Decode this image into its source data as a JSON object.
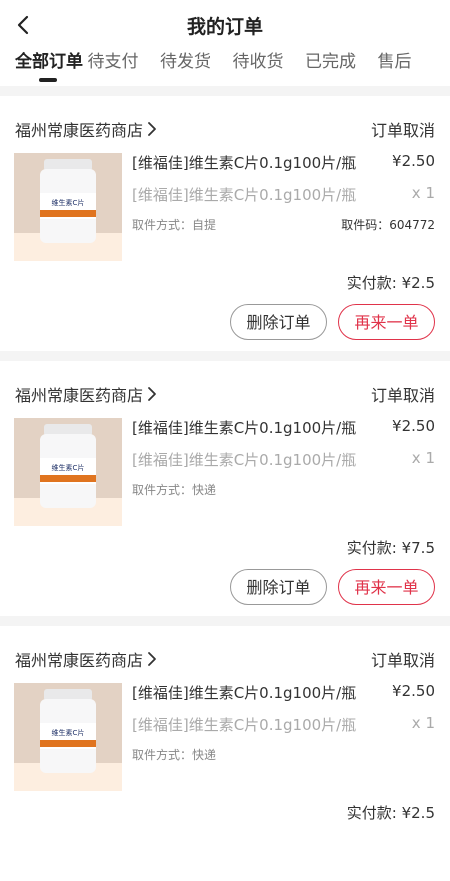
{
  "header": {
    "title": "我的订单"
  },
  "tabs": [
    {
      "label": "全部订单"
    },
    {
      "label": "待支付"
    },
    {
      "label": "待发货"
    },
    {
      "label": "待收货"
    },
    {
      "label": "已完成"
    },
    {
      "label": "售后"
    }
  ],
  "orders": [
    {
      "store": "福州常康医药商店",
      "status": "订单取消",
      "product_label": "维生素C片",
      "product_name": "[维福佳]维生素C片0.1g100片/瓶",
      "price": "¥2.50",
      "product_name_sub": "[维福佳]维生素C片0.1g100片/瓶",
      "qty": "x 1",
      "pickup": "取件方式：自提",
      "pickup_code": "取件码：604772",
      "paid": "实付款: ¥2.5",
      "delete_label": "删除订单",
      "reorder_label": "再来一单"
    },
    {
      "store": "福州常康医药商店",
      "status": "订单取消",
      "product_label": "维生素C片",
      "product_name": "[维福佳]维生素C片0.1g100片/瓶",
      "price": "¥2.50",
      "product_name_sub": "[维福佳]维生素C片0.1g100片/瓶",
      "qty": "x 1",
      "pickup": "取件方式：快递",
      "paid": "实付款: ¥7.5",
      "delete_label": "删除订单",
      "reorder_label": "再来一单"
    },
    {
      "store": "福州常康医药商店",
      "status": "订单取消",
      "product_label": "维生素C片",
      "product_name": "[维福佳]维生素C片0.1g100片/瓶",
      "price": "¥2.50",
      "product_name_sub": "[维福佳]维生素C片0.1g100片/瓶",
      "qty": "x 1",
      "pickup": "取件方式：快递",
      "paid": "实付款: ¥2.5"
    }
  ],
  "colors": {
    "accent": "#e0334a",
    "active_tab": "#222222"
  },
  "icons": {
    "back": "chevron-left-icon",
    "store_arrow": "chevron-right-icon"
  }
}
